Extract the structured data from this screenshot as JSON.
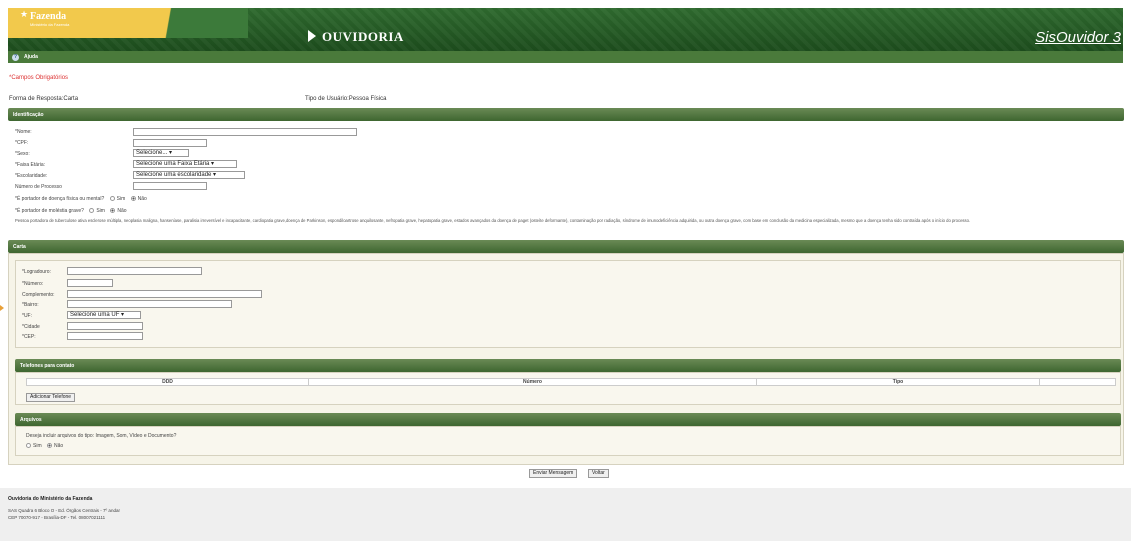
{
  "header": {
    "org_name": "Fazenda",
    "org_subtitle": "Ministério da Fazenda",
    "title": "OUVIDORIA",
    "app_name": "SisOuvidor 3",
    "help_label": "Ajuda"
  },
  "required_note": "*Campos Obrigatórios",
  "info": {
    "forma_resposta": "Forma de Resposta:Carta",
    "tipo_usuario": "Tipo de Usuário:Pessoa Física"
  },
  "identificacao": {
    "title": "Identificação",
    "nome": "*Nome:",
    "cpf": "*CPF:",
    "sexo": "*Sexo:",
    "sexo_value": "Selecione...",
    "faixa": "*Faixa Etária:",
    "faixa_value": "Selecione uma Faixa Etária",
    "escolaridade": "*Escolaridade:",
    "escolaridade_value": "Selecione uma escolaridade",
    "processo": "Número de Processo",
    "doenca": "*É portador de doença física ou mental?",
    "molestia": "*É portador de moléstia grave?",
    "sim": "Sim",
    "nao": "Não",
    "note": "Pessoa portadora de tuberculose ativa esclerose múltipla, neoplasia maligna, hanseníase, paralisia irreversível e incapacitante, cardiopatia grave,doença de Parkinson, espondiloartrose anquilosante, nefropatia grave, hepatopatia grave, estados avançados da doença de paget (osteíte deformante), contaminação por radiação, síndrome de imunodeficiência adquirida, ou outra doença grave, com base em conclusão da medicina especializada, mesmo que a doença tenha sido contraída após o início do processo."
  },
  "carta": {
    "title": "Carta",
    "logradouro": "*Logradouro:",
    "numero": "*Número:",
    "complemento": "Complemento:",
    "bairro": "*Bairro:",
    "uf": "*UF:",
    "uf_value": "Selecione uma UF",
    "cidade": "*Cidade",
    "cep": "*CEP:"
  },
  "telefones": {
    "title": "Telefones para contato",
    "columns": [
      "DDD",
      "Número",
      "Tipo",
      ""
    ],
    "add_button": "Adicionar Telefone"
  },
  "arquivos": {
    "title": "Arquivos",
    "question": "Deseja incluir arquivos do tipo: Imagem, Som, Vídeo e Documento?",
    "sim": "Sim",
    "nao": "Não"
  },
  "actions": {
    "send": "Enviar Mensagem",
    "back": "Voltar"
  },
  "footer": {
    "title": "Ouvidoria do Ministério da Fazenda",
    "address1": "SAS Quadra 6 Bloco O - Ed. Órgãos Centrais - 7º andar",
    "address2": "CEP 70070-917 - Brasília-DF - Tel. 08007021111"
  }
}
